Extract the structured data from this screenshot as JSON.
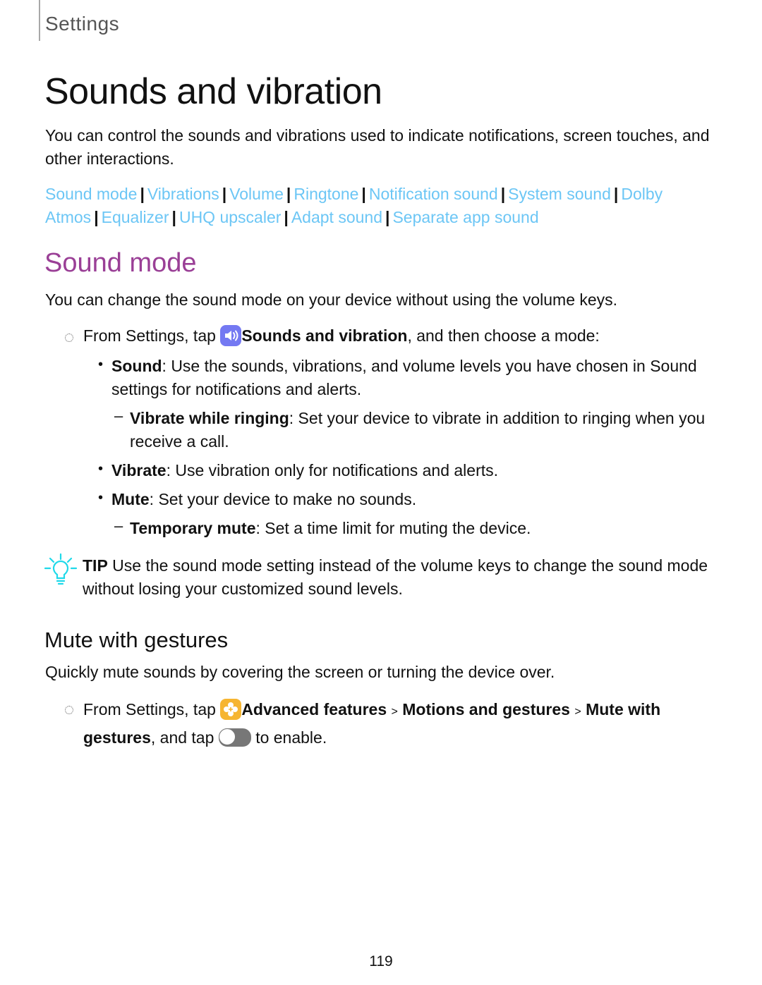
{
  "header": {
    "section_label": "Settings"
  },
  "page": {
    "title": "Sounds and vibration",
    "intro": "You can control the sounds and vibrations used to indicate notifications, screen touches, and other interactions.",
    "nav_links": [
      "Sound mode",
      "Vibrations",
      "Volume",
      "Ringtone",
      "Notification sound",
      "System sound",
      "Dolby Atmos",
      "Equalizer",
      "UHQ upscaler",
      "Adapt sound",
      "Separate app sound"
    ],
    "link_separator": "|",
    "page_number": "119"
  },
  "sound_mode": {
    "title": "Sound mode",
    "description": "You can change the sound mode on your device without using the volume keys.",
    "step": {
      "prefix": "From Settings, tap",
      "icon": "sounds-and-vibration-icon",
      "bold": "Sounds and vibration",
      "suffix": ", and then choose a mode:"
    },
    "modes": [
      {
        "name": "Sound",
        "text": ": Use the sounds, vibrations, and volume levels you have chosen in Sound settings for notifications and alerts."
      },
      {
        "name": "Vibrate while ringing",
        "text": ": Set your device to vibrate in addition to ringing when you receive a call.",
        "sub": true
      },
      {
        "name": "Vibrate",
        "text": ": Use vibration only for notifications and alerts."
      },
      {
        "name": "Mute",
        "text": ": Set your device to make no sounds."
      },
      {
        "name": "Temporary mute",
        "text": ": Set a time limit for muting the device.",
        "sub": true
      }
    ],
    "tip": {
      "label": "TIP",
      "text": "Use the sound mode setting instead of the volume keys to change the sound mode without losing your customized sound levels."
    }
  },
  "mute_gestures": {
    "title": "Mute with gestures",
    "description": "Quickly mute sounds by covering the screen or turning the device over.",
    "step": {
      "prefix": "From Settings, tap",
      "icon": "advanced-features-icon",
      "path": [
        "Advanced features",
        "Motions and gestures",
        "Mute with gestures"
      ],
      "path_separator": ">",
      "middle": ", and tap",
      "toggle_icon": "toggle-switch-icon",
      "suffix": "to enable."
    }
  },
  "colors": {
    "link": "#6cc6f5",
    "section_title": "#9a3f96",
    "tip_icon": "#1fd9e9",
    "sound_icon_bg": "#7479f2",
    "advanced_icon_bg": "#f6b531"
  }
}
